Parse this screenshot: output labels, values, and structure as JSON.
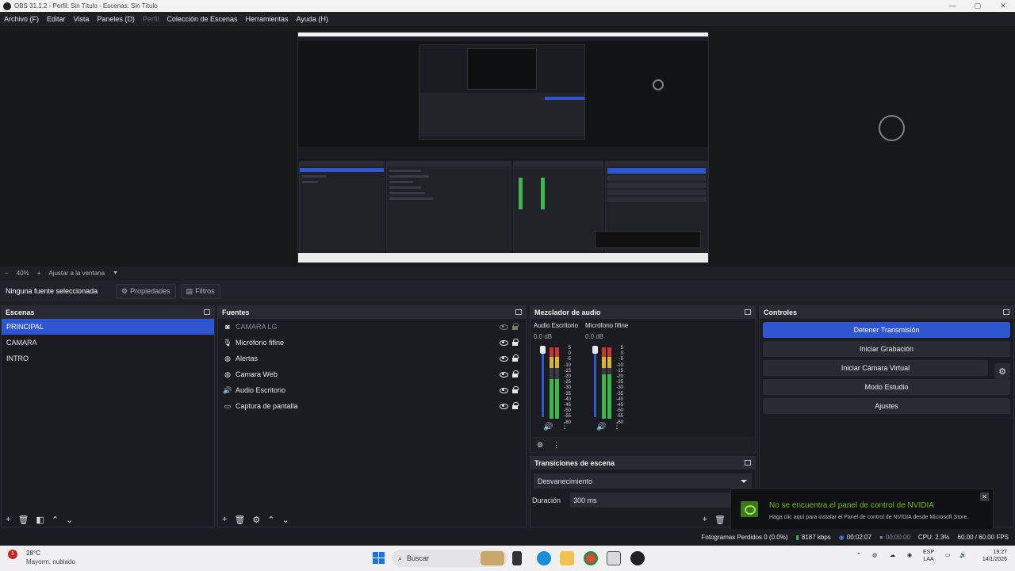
{
  "window": {
    "title": "OBS 31.1.2 - Perfil: Sin Título - Escenas: Sin Título",
    "min": "—",
    "max": "▢",
    "close": "✕"
  },
  "menu": [
    "Archivo (F)",
    "Editar",
    "Vista",
    "Paneles (D)",
    "Perfil",
    "Colección de Escenas",
    "Herramientas",
    "Ayuda (H)"
  ],
  "zoom": {
    "minus": "−",
    "level": "40%",
    "plus": "+",
    "fit": "Ajustar a la ventana"
  },
  "source_bar": {
    "none_selected": "Ninguna fuente seleccionada",
    "properties": "Propiedades",
    "filters": "Filtros"
  },
  "scenes": {
    "title": "Escenas",
    "items": [
      "PRINCIPAL",
      "CAMARA",
      "INTRO"
    ],
    "selected": "PRINCIPAL"
  },
  "sources": {
    "title": "Fuentes",
    "items": [
      {
        "name": "CAMARA LG",
        "icon": "camera-icon",
        "visible": false
      },
      {
        "name": "Micrófono fifine",
        "icon": "microphone-icon",
        "visible": true
      },
      {
        "name": "Alertas",
        "icon": "globe-icon",
        "visible": true
      },
      {
        "name": "Camara Web",
        "icon": "globe-icon",
        "visible": true
      },
      {
        "name": "Audio Escritorio",
        "icon": "speaker-icon",
        "visible": true
      },
      {
        "name": "Captura de pantalla",
        "icon": "monitor-icon",
        "visible": true
      }
    ]
  },
  "mixer": {
    "title": "Mezclador de audio",
    "channels": [
      {
        "name": "Audio Escritorio",
        "db": "0.0 dB",
        "level": 0.55
      },
      {
        "name": "Micrófono fifine",
        "db": "0.0 dB",
        "level": 0.62
      }
    ],
    "ticks": [
      "5",
      "0",
      "-5",
      "-10",
      "-15",
      "-20",
      "-25",
      "-30",
      "-35",
      "-40",
      "-45",
      "-50",
      "-55",
      "-60"
    ]
  },
  "transitions": {
    "title": "Transiciones de escena",
    "selected": "Desvanecimiento",
    "duration_label": "Duración",
    "duration_value": "300 ms"
  },
  "controls": {
    "title": "Controles",
    "buttons": [
      "Detener Transmisión",
      "Iniciar Grabación",
      "Iniciar Cámara Virtual",
      "Modo Estudio",
      "Ajustes"
    ]
  },
  "status": {
    "dropped": "Fotogramas Perdidos 0 (0.0%)",
    "bitrate": "8187 kbps",
    "stream_time": "00:02:07",
    "rec_time": "00:00:00",
    "cpu": "CPU: 2.3%",
    "fps": "60.00 / 60.00 FPS"
  },
  "notification": {
    "title": "No se encuentra el panel de control de NVIDIA",
    "body": "Haga clic aquí para instalar el Panel de control de NVIDIA desde Microsoft Store."
  },
  "taskbar": {
    "temp": "28°C",
    "weather": "Mayorm. nublado",
    "weather_badge": "1",
    "search": "Buscar",
    "lang1": "ESP",
    "lang2": "LAA",
    "time": "19:27",
    "date": "14/1/2026"
  }
}
